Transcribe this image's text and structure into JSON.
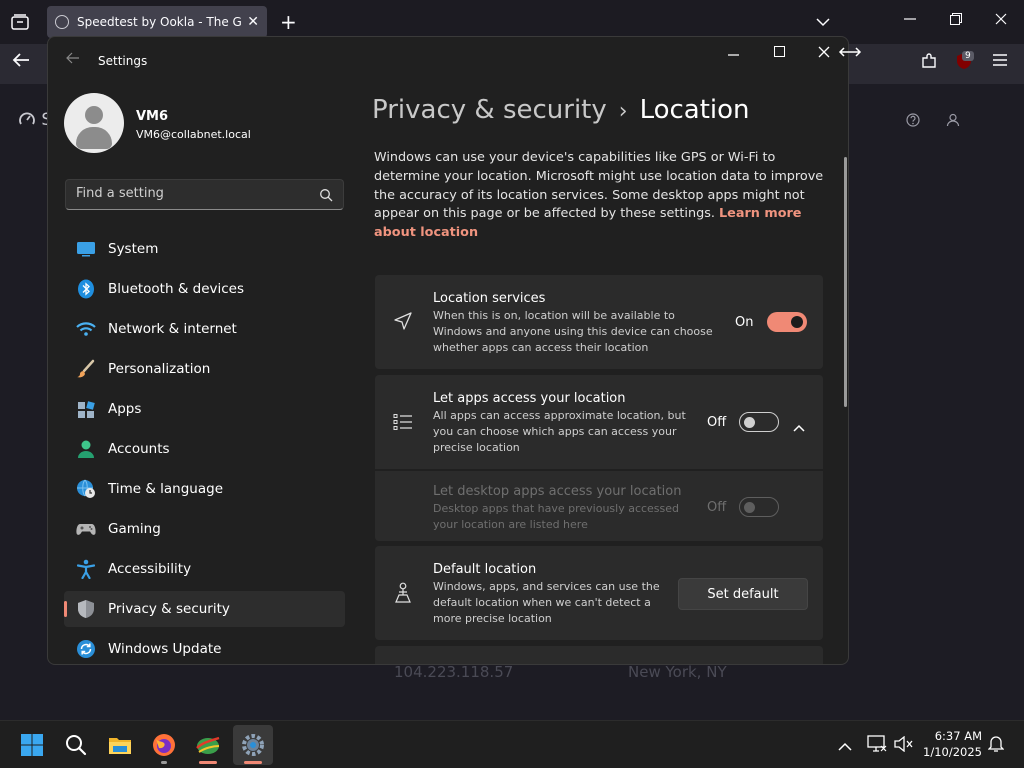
{
  "browser": {
    "tab_title": "Speedtest by Ookla - The Global Broadband Speed Test",
    "tab_close": "✕",
    "new_tab": "+",
    "extension_badge": "9",
    "page_letter": "S",
    "page_ip": "104.223.118.57",
    "page_city": "New York, NY"
  },
  "settings": {
    "app_title": "Settings",
    "user": {
      "name": "VM6",
      "email": "VM6@collabnet.local"
    },
    "search": {
      "placeholder": "Find a setting"
    },
    "nav": [
      {
        "label": "System",
        "icon": "system-icon"
      },
      {
        "label": "Bluetooth & devices",
        "icon": "bluetooth-icon"
      },
      {
        "label": "Network & internet",
        "icon": "wifi-icon"
      },
      {
        "label": "Personalization",
        "icon": "brush-icon"
      },
      {
        "label": "Apps",
        "icon": "apps-icon"
      },
      {
        "label": "Accounts",
        "icon": "accounts-icon"
      },
      {
        "label": "Time & language",
        "icon": "globe-clock-icon"
      },
      {
        "label": "Gaming",
        "icon": "gamepad-icon"
      },
      {
        "label": "Accessibility",
        "icon": "accessibility-icon"
      },
      {
        "label": "Privacy & security",
        "icon": "shield-icon",
        "active": true
      },
      {
        "label": "Windows Update",
        "icon": "update-icon"
      }
    ],
    "breadcrumb": {
      "parent": "Privacy & security",
      "separator": "›",
      "current": "Location"
    },
    "description": "Windows can use your device's capabilities like GPS or Wi-Fi to determine your location. Microsoft might use location data to improve the accuracy of its location services. Some desktop apps might not appear on this page or be affected by these settings.",
    "learn_more": "Learn more about location",
    "cards": {
      "location_services": {
        "title": "Location services",
        "desc": "When this is on, location will be available to Windows and anyone using this device can choose whether apps can access their location",
        "state": "On"
      },
      "apps_access": {
        "title": "Let apps access your location",
        "desc": "All apps can access approximate location, but you can choose which apps can access your precise location",
        "state": "Off"
      },
      "desktop_apps": {
        "title": "Let desktop apps access your location",
        "desc": "Desktop apps that have previously accessed your location are listed here",
        "state": "Off"
      },
      "default_location": {
        "title": "Default location",
        "desc": "Windows, apps, and services can use the default location when we can't detect a more precise location",
        "button": "Set default"
      }
    }
  },
  "taskbar": {
    "time": "6:37 AM",
    "date": "1/10/2025"
  },
  "colors": {
    "accent": "#f08975",
    "window_bg": "#202020",
    "card_bg": "#2b2b2b"
  }
}
